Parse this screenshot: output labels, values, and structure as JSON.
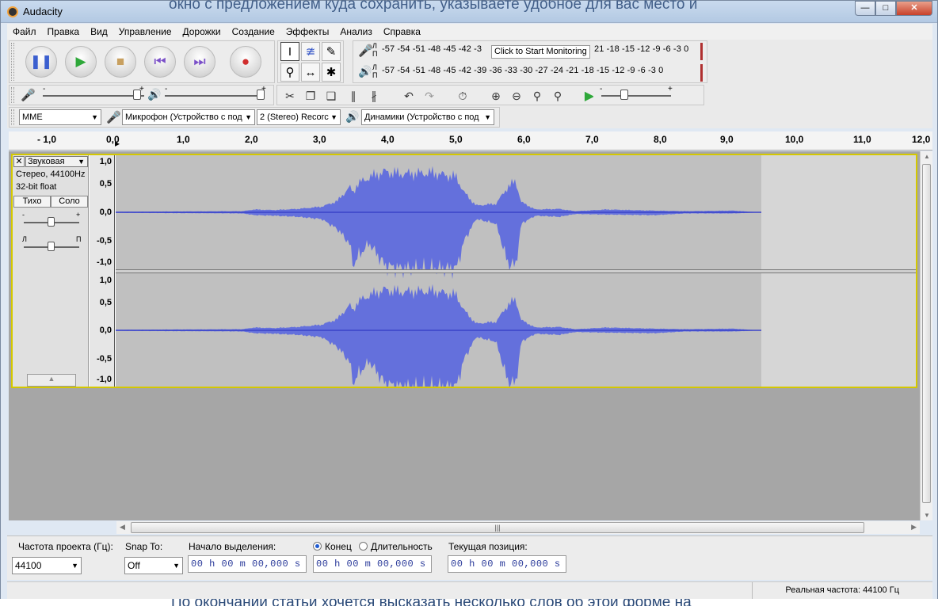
{
  "window": {
    "title": "Audacity",
    "background_text": "окно с предложением куда сохранить, указываете удобное для вас место и",
    "bottom_text": "По окончании статьи хочется высказать несколько слов об этой форме на"
  },
  "menu": [
    "Файл",
    "Правка",
    "Вид",
    "Управление",
    "Дорожки",
    "Создание",
    "Эффекты",
    "Анализ",
    "Справка"
  ],
  "meters": {
    "record_channels": "Л\nП",
    "play_channels": "Л\nП",
    "record_scale": "-57 -54 -51 -48 -45 -42 -3",
    "record_scale_tail": "21 -18 -15 -12  -9  -6  -3  0",
    "play_scale": "-57 -54 -51 -48 -45 -42 -39 -36 -33 -30 -27 -24 -21 -18 -15 -12  -9  -6  -3  0",
    "monitor_hint": "Click to Start Monitoring"
  },
  "mixer": {
    "minus": "-",
    "plus": "+"
  },
  "devices": {
    "host": "MME",
    "input": "Микрофон (Устройство с под",
    "channels": "2 (Stereo) Recorc",
    "output": "Динамики (Устройство с под"
  },
  "ruler": {
    "ticks": [
      "- 1,0",
      "0,0",
      "1,0",
      "2,0",
      "3,0",
      "4,0",
      "5,0",
      "6,0",
      "7,0",
      "8,0",
      "9,0",
      "10,0",
      "11,0",
      "12,0"
    ]
  },
  "track": {
    "name": "Звуковая",
    "info1": "Стерео, 44100Hz",
    "info2": "32-bit float",
    "mute": "Тихо",
    "solo": "Соло",
    "gain_minus": "-",
    "gain_plus": "+",
    "pan_left": "Л",
    "pan_right": "П",
    "scale_top": [
      "1,0",
      "0,5",
      "0,0",
      "-0,5",
      "-1,0"
    ],
    "scale_bottom": [
      "1,0",
      "0,5",
      "0,0",
      "-0,5",
      "-1,0"
    ],
    "wave_color": "#6470dc",
    "wave_peak_color": "#3a43c8"
  },
  "selection": {
    "project_rate_label": "Частота проекта (Гц):",
    "project_rate": "44100",
    "snap_label": "Snap To:",
    "snap_value": "Off",
    "start_label": "Начало выделения:",
    "end_label": "Конец",
    "length_label": "Длительность",
    "position_label": "Текущая позиция:",
    "start_time": "00 h 00 m 00,000 s",
    "end_time": "00 h 00 m 00,000 s",
    "pos_time": "00 h 00 m 00,000 s"
  },
  "status": {
    "actual_rate": "Реальная частота: 44100 Гц"
  }
}
